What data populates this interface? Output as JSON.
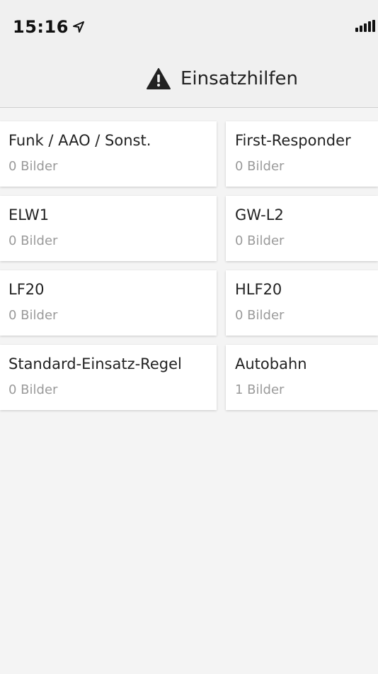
{
  "status_bar": {
    "time": "15:16",
    "location_icon": "location-arrow-icon",
    "signal_icon": "cellular-signal-icon"
  },
  "nav": {
    "title": "Einsatzhilfen",
    "icon": "warning-icon"
  },
  "cards": [
    {
      "title": "Funk / AAO / Sonst.",
      "subtitle": "0 Bilder"
    },
    {
      "title": "First-Responder",
      "subtitle": "0 Bilder"
    },
    {
      "title": "ELW1",
      "subtitle": "0 Bilder"
    },
    {
      "title": "GW-L2",
      "subtitle": "0 Bilder"
    },
    {
      "title": "LF20",
      "subtitle": "0 Bilder"
    },
    {
      "title": "HLF20",
      "subtitle": "0 Bilder"
    },
    {
      "title": "Standard-Einsatz-Regel",
      "subtitle": "0 Bilder"
    },
    {
      "title": "Autobahn",
      "subtitle": "1 Bilder"
    }
  ]
}
